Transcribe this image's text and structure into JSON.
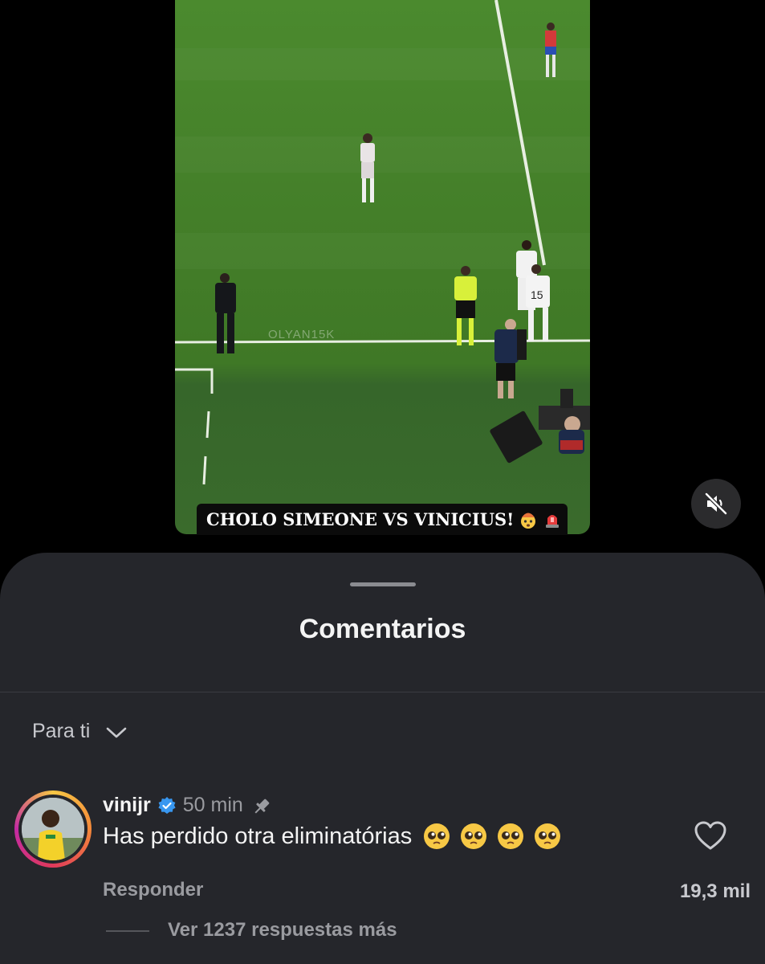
{
  "video": {
    "watermark": "OLYAN15K",
    "caption": "CHOLO SIMEONE VS VINICIUS!",
    "caption_emojis": [
      "exploding-head-emoji",
      "police-light-emoji"
    ],
    "mute_icon": "speaker-muted-icon"
  },
  "sheet": {
    "title": "Comentarios",
    "sort_label": "Para ti"
  },
  "comments": [
    {
      "username": "vinijr",
      "verified": true,
      "time": "50 min",
      "pinned": true,
      "text": "Has perdido otra eliminatórias",
      "emojis": [
        "pleading-face-emoji",
        "pleading-face-emoji",
        "pleading-face-emoji",
        "pleading-face-emoji"
      ],
      "reply_label": "Responder",
      "likes": "19,3 mil",
      "view_replies": "Ver 1237 respuestas más"
    }
  ],
  "colors": {
    "sheet_bg": "#25262b",
    "verified_blue": "#3897f0",
    "muted_text": "#9a9ba0"
  }
}
